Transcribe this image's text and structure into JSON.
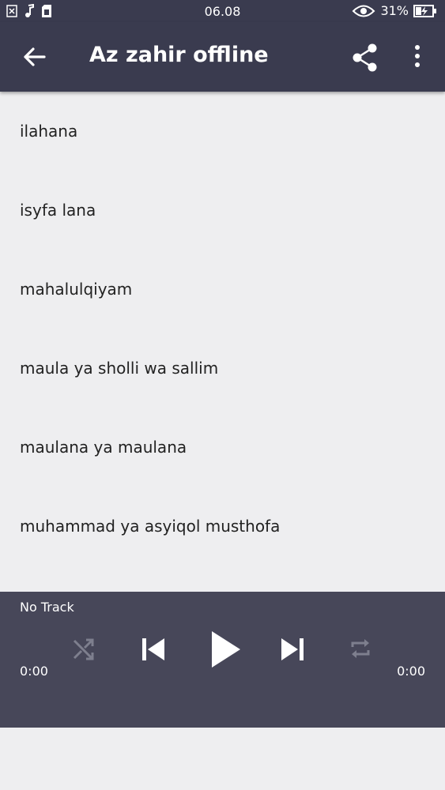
{
  "status_bar": {
    "time": "06.08",
    "battery_percent": "31%",
    "icons": [
      "notification-x-icon",
      "music-note-icon",
      "sim-icon",
      "eye-icon",
      "battery-charging-icon"
    ]
  },
  "app_bar": {
    "title": "Az zahir offline",
    "icons": [
      "back-arrow-icon",
      "share-icon",
      "more-vert-icon"
    ]
  },
  "tracks": [
    "ilahana",
    "isyfa lana",
    "mahalulqiyam",
    "maula ya sholli wa sallim",
    "maulana ya maulana",
    "muhammad ya asyiqol musthofa"
  ],
  "player": {
    "track_label": "No Track",
    "elapsed": "0:00",
    "duration": "0:00",
    "controls": [
      "shuffle-icon",
      "skip-previous-icon",
      "play-icon",
      "skip-next-icon",
      "repeat-icon"
    ]
  },
  "colors": {
    "bar": "#3a3b4f",
    "player": "#474759",
    "background": "#eeeef0",
    "disabled_icon": "#7e7f8e"
  }
}
